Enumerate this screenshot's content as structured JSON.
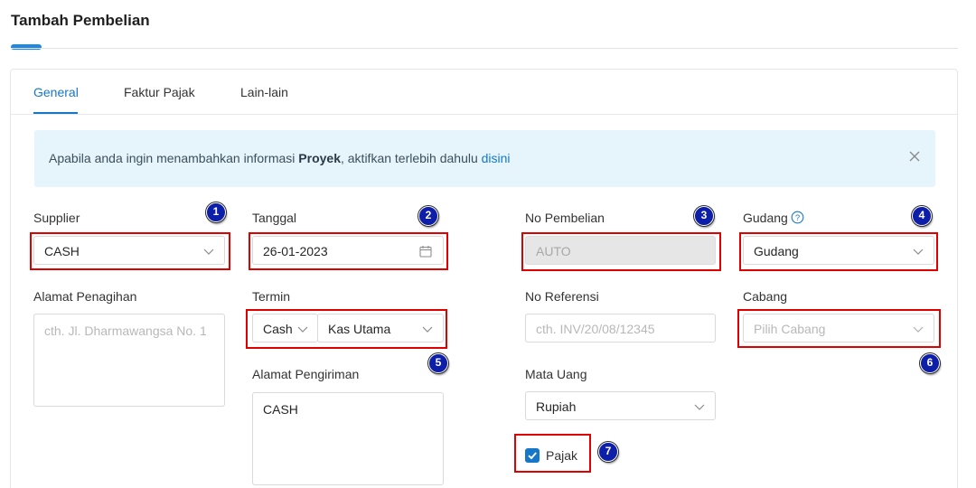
{
  "page": {
    "title": "Tambah Pembelian"
  },
  "tabs": [
    {
      "label": "General",
      "active": true
    },
    {
      "label": "Faktur Pajak",
      "active": false
    },
    {
      "label": "Lain-lain",
      "active": false
    }
  ],
  "alert": {
    "text_before": "Apabila anda ingin menambahkan informasi ",
    "bold": "Proyek",
    "text_after": ", aktifkan terlebih dahulu ",
    "link": "disini",
    "close_icon": "close-icon"
  },
  "form": {
    "supplier": {
      "label": "Supplier",
      "value": "CASH"
    },
    "tanggal": {
      "label": "Tanggal",
      "value": "26-01-2023"
    },
    "no_pembelian": {
      "label": "No Pembelian",
      "value": "AUTO"
    },
    "gudang": {
      "label": "Gudang",
      "value": "Gudang"
    },
    "alamat_penagihan": {
      "label": "Alamat Penagihan",
      "placeholder": "cth. Jl. Dharmawangsa No. 1"
    },
    "termin": {
      "label": "Termin",
      "type_value": "Cash",
      "account_value": "Kas Utama"
    },
    "no_referensi": {
      "label": "No Referensi",
      "placeholder": "cth. INV/20/08/12345"
    },
    "cabang": {
      "label": "Cabang",
      "placeholder": "Pilih Cabang"
    },
    "alamat_pengiriman": {
      "label": "Alamat Pengiriman",
      "value": "CASH"
    },
    "mata_uang": {
      "label": "Mata Uang",
      "value": "Rupiah"
    },
    "pajak": {
      "label": "Pajak",
      "checked": true
    }
  },
  "annotations": [
    "1",
    "2",
    "3",
    "4",
    "5",
    "6",
    "7"
  ],
  "colors": {
    "primary": "#1677c8",
    "highlight": "#e00000",
    "badge": "#0d1fa8",
    "alert_bg": "#e6f5fb"
  }
}
